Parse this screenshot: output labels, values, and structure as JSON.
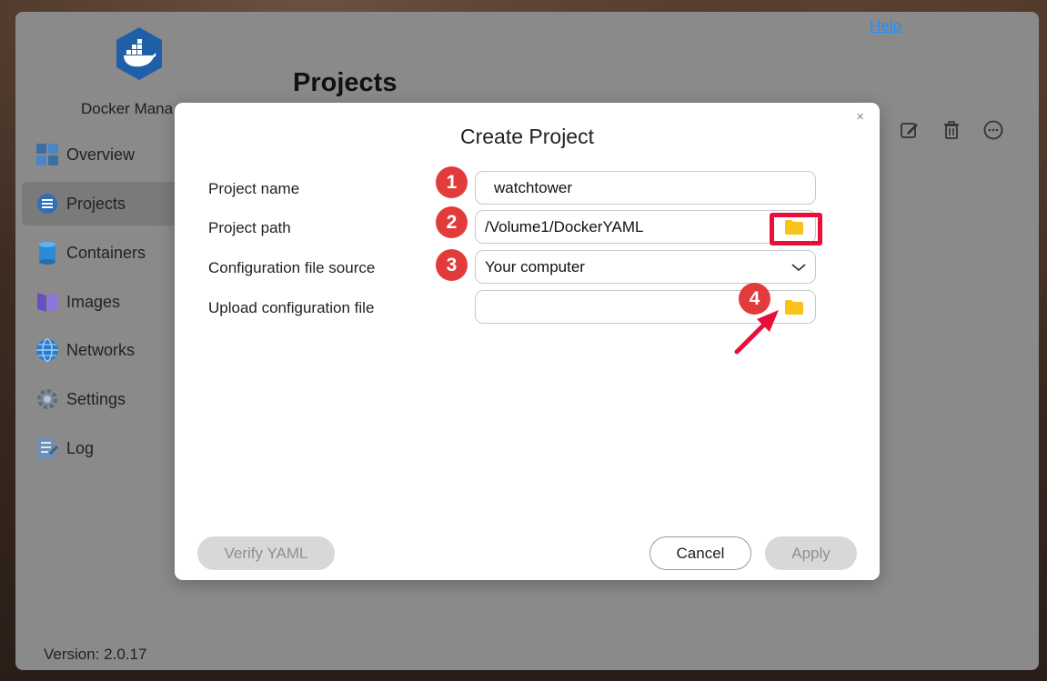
{
  "app": {
    "name": "Docker Mana",
    "page_title": "Projects",
    "help_label": "Help",
    "version": "Version: 2.0.17"
  },
  "sidebar": {
    "items": [
      {
        "label": "Overview",
        "icon": "overview-grid-icon"
      },
      {
        "label": "Projects",
        "icon": "projects-list-icon",
        "active": true
      },
      {
        "label": "Containers",
        "icon": "containers-cylinder-icon"
      },
      {
        "label": "Images",
        "icon": "images-icon"
      },
      {
        "label": "Networks",
        "icon": "networks-globe-icon"
      },
      {
        "label": "Settings",
        "icon": "settings-gear-icon"
      },
      {
        "label": "Log",
        "icon": "log-document-icon"
      }
    ]
  },
  "toolbar": {
    "icons": [
      "edit-icon",
      "trash-icon",
      "more-icon"
    ]
  },
  "modal": {
    "title": "Create Project",
    "close": "×",
    "fields": {
      "project_name": {
        "label": "Project name",
        "value": "watchtower"
      },
      "project_path": {
        "label": "Project path",
        "value": "/Volume1/DockerYAML"
      },
      "config_source": {
        "label": "Configuration file source",
        "value": "Your computer"
      },
      "upload_config": {
        "label": "Upload configuration file",
        "value": ""
      }
    },
    "badges": [
      "1",
      "2",
      "3",
      "4"
    ],
    "buttons": {
      "verify": "Verify YAML",
      "cancel": "Cancel",
      "apply": "Apply"
    }
  },
  "colors": {
    "accent_red": "#e23b3b",
    "highlight": "#e8103a",
    "folder": "#f7c31b",
    "docker_blue": "#1f5fa8",
    "link": "#1e90ff"
  }
}
